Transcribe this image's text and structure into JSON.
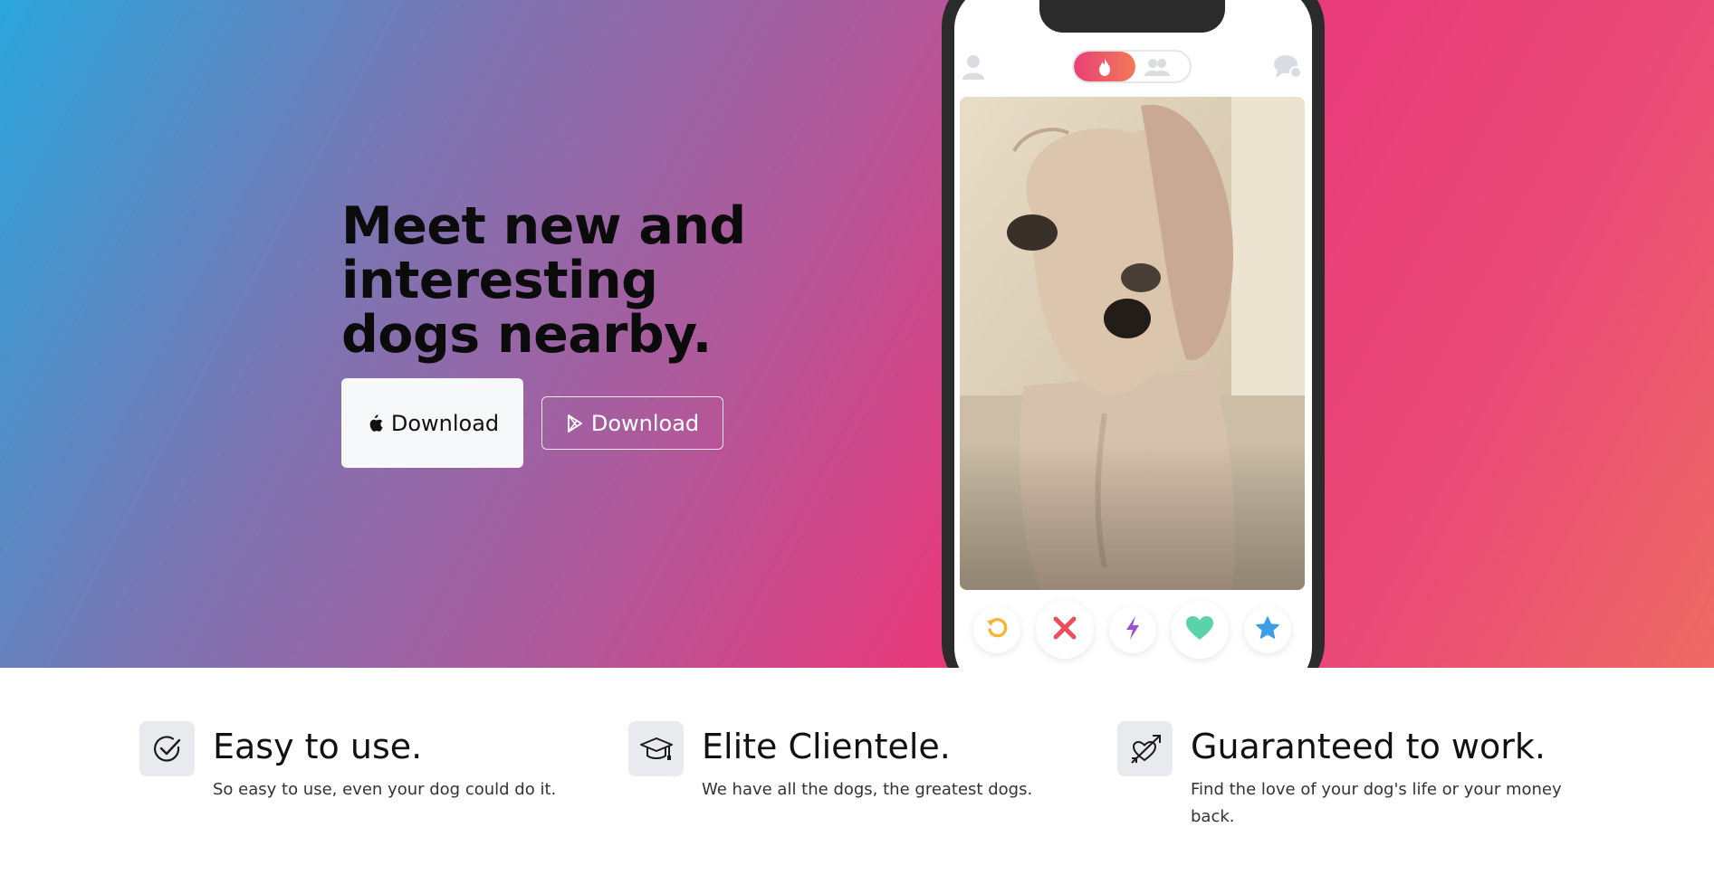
{
  "hero": {
    "title": "Meet new and interesting dogs nearby.",
    "apple_button": {
      "label": "Download",
      "icon": "apple-icon"
    },
    "play_button": {
      "label": "Download",
      "icon": "google-play-icon"
    }
  },
  "phone": {
    "toggle_active_icon": "flame-icon",
    "toggle_inactive_icon": "group-icon",
    "top_left_icon": "profile-icon",
    "top_right_icon": "chat-icon",
    "card_image": "dog-photo",
    "actions": [
      {
        "name": "rewind",
        "icon": "rewind-icon",
        "color": "#f5b731"
      },
      {
        "name": "nope",
        "icon": "close-icon",
        "color": "#ee4d5f"
      },
      {
        "name": "boost",
        "icon": "lightning-icon",
        "color": "#9b4fd6"
      },
      {
        "name": "like",
        "icon": "heart-icon",
        "color": "#5ad3a8"
      },
      {
        "name": "super-like",
        "icon": "star-icon",
        "color": "#3a9ee8"
      }
    ]
  },
  "features": [
    {
      "icon": "check-circle-icon",
      "title": "Easy to use.",
      "description": "So easy to use, even your dog could do it."
    },
    {
      "icon": "graduation-cap-icon",
      "title": "Elite Clientele.",
      "description": "We have all the dogs, the greatest dogs."
    },
    {
      "icon": "heart-arrow-icon",
      "title": "Guaranteed to work.",
      "description": "Find the love of your dog's life or your money back."
    }
  ],
  "colors": {
    "gradient_start": "#2aa6dc",
    "gradient_mid": "#e8397a",
    "gradient_end": "#ee6a62",
    "icon_tile": "#e8eaee"
  }
}
